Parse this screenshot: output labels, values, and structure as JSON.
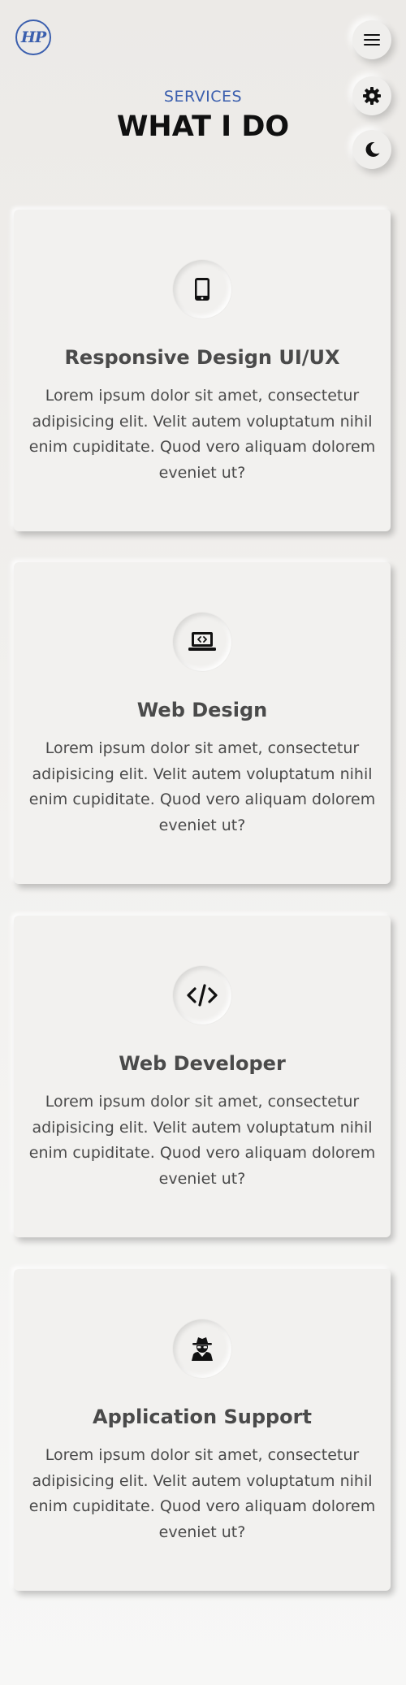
{
  "header": {
    "logo_text": "HP"
  },
  "section": {
    "subtitle": "SERVICES",
    "title": "WHAT I DO"
  },
  "services": [
    {
      "icon": "mobile-icon",
      "title": "Responsive Design UI/UX",
      "description": "Lorem ipsum dolor sit amet, consectetur adipisicing elit. Velit autem voluptatum nihil enim cupiditate. Quod vero aliquam dolorem eveniet ut?"
    },
    {
      "icon": "laptop-code-icon",
      "title": "Web Design",
      "description": "Lorem ipsum dolor sit amet, consectetur adipisicing elit. Velit autem voluptatum nihil enim cupiditate. Quod vero aliquam dolorem eveniet ut?"
    },
    {
      "icon": "code-icon",
      "title": "Web Developer",
      "description": "Lorem ipsum dolor sit amet, consectetur adipisicing elit. Velit autem voluptatum nihil enim cupiditate. Quod vero aliquam dolorem eveniet ut?"
    },
    {
      "icon": "user-secret-icon",
      "title": "Application Support",
      "description": "Lorem ipsum dolor sit amet, consectetur adipisicing elit. Velit autem voluptatum nihil enim cupiditate. Quod vero aliquam dolorem eveniet ut?"
    }
  ],
  "controls": {
    "menu_icon": "hamburger-menu-icon",
    "settings_icon": "gear-icon",
    "theme_icon": "moon-icon"
  },
  "colors": {
    "accent": "#3b5fae",
    "title": "#101010",
    "text": "#4a4a4a",
    "background": "#eceae7"
  }
}
